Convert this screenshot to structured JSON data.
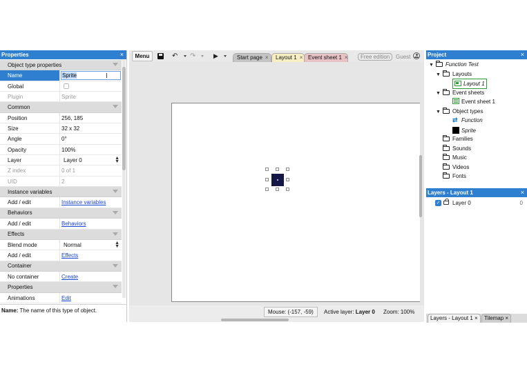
{
  "properties": {
    "title": "Properties",
    "close": "×",
    "rows": [
      {
        "type": "section",
        "label": "Object type properties"
      },
      {
        "type": "prop",
        "name": "Name",
        "value": "Sprite",
        "selected": true,
        "editing": true
      },
      {
        "type": "prop",
        "name": "Global",
        "value": "",
        "checkbox": true
      },
      {
        "type": "prop",
        "name": "Plugin",
        "value": "Sprite",
        "readonly": true
      },
      {
        "type": "section",
        "label": "Common"
      },
      {
        "type": "prop",
        "name": "Position",
        "value": "256, 185",
        "expand": true
      },
      {
        "type": "prop",
        "name": "Size",
        "value": "32 x 32",
        "expand": true
      },
      {
        "type": "prop",
        "name": "Angle",
        "value": "0°"
      },
      {
        "type": "prop",
        "name": "Opacity",
        "value": "100%"
      },
      {
        "type": "prop",
        "name": "Layer",
        "value": "Layer 0",
        "select": true
      },
      {
        "type": "prop",
        "name": "Z index",
        "value": "0 of 1",
        "readonly": true
      },
      {
        "type": "prop",
        "name": "UID",
        "value": "2",
        "readonly": true
      },
      {
        "type": "section",
        "label": "Instance variables"
      },
      {
        "type": "prop",
        "name": "Add / edit",
        "value": "Instance variables",
        "link": true
      },
      {
        "type": "section",
        "label": "Behaviors"
      },
      {
        "type": "prop",
        "name": "Add / edit",
        "value": "Behaviors",
        "link": true
      },
      {
        "type": "section",
        "label": "Effects"
      },
      {
        "type": "prop",
        "name": "Blend mode",
        "value": "Normal",
        "select": true
      },
      {
        "type": "prop",
        "name": "Add / edit",
        "value": "Effects",
        "link": true
      },
      {
        "type": "section",
        "label": "Container"
      },
      {
        "type": "prop",
        "name": "No container",
        "value": "Create",
        "link": true
      },
      {
        "type": "section",
        "label": "Properties"
      },
      {
        "type": "prop",
        "name": "Animations",
        "value": "Edit",
        "link": true
      }
    ],
    "description_label": "Name:",
    "description_text": " The name of this type of object."
  },
  "toolbar": {
    "menu_label": "Menu",
    "icons": [
      "save-icon",
      "undo-icon",
      "redo-icon",
      "play-icon"
    ],
    "tabs": [
      {
        "label": "Start page",
        "close": "×"
      },
      {
        "label": "Layout 1",
        "close": "×"
      },
      {
        "label": "Event sheet 1",
        "close": "×"
      }
    ],
    "free_badge": "Free edition",
    "guest_label": "Guest"
  },
  "status": {
    "mouse": "Mouse: (-157, -59)",
    "active_layer_label": "Active layer: ",
    "active_layer_value": "Layer 0",
    "zoom": "Zoom: 100%"
  },
  "project": {
    "title": "Project",
    "close": "×",
    "items": [
      {
        "label": "Function Test",
        "icon": "folder",
        "twisty": "▼",
        "italic": true
      },
      {
        "label": "Layouts",
        "icon": "folder",
        "twisty": "▼"
      },
      {
        "label": "Layout 1",
        "icon": "layout",
        "italic": true,
        "selected": true
      },
      {
        "label": "Event sheets",
        "icon": "folder",
        "twisty": "▼"
      },
      {
        "label": "Event sheet 1",
        "icon": "event-sheet"
      },
      {
        "label": "Object types",
        "icon": "folder",
        "twisty": "▼"
      },
      {
        "label": "Function",
        "icon": "function",
        "italic": true
      },
      {
        "label": "Sprite",
        "icon": "sprite",
        "italic": true
      },
      {
        "label": "Families",
        "icon": "folder"
      },
      {
        "label": "Sounds",
        "icon": "folder"
      },
      {
        "label": "Music",
        "icon": "folder"
      },
      {
        "label": "Videos",
        "icon": "folder"
      },
      {
        "label": "Fonts",
        "icon": "folder"
      }
    ]
  },
  "layers": {
    "title": "Layers - Layout 1",
    "close": "×",
    "rows": [
      {
        "name": "Layer 0",
        "count": "0",
        "visible": true
      }
    ]
  },
  "bottom_tabs": [
    {
      "label": "Layers - Layout 1",
      "close": "×"
    },
    {
      "label": "Tilemap",
      "close": "×"
    }
  ],
  "colors": {
    "header_blue": "#2f7fd0",
    "sprite": "#141646",
    "tab_layout": "#f7efc3",
    "tab_event": "#e9c2c6",
    "link": "#1a43d8"
  }
}
